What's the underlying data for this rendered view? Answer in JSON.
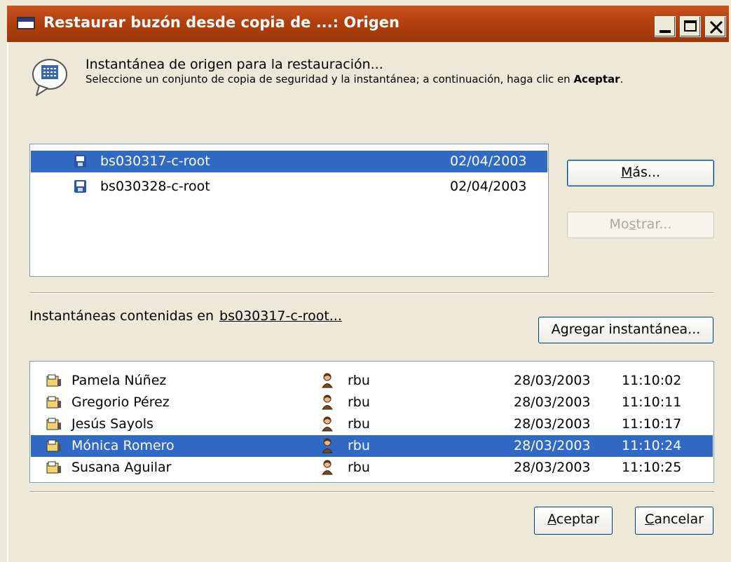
{
  "window": {
    "title": "Restaurar buzón desde copia de ...: Origen"
  },
  "header": {
    "title": "Instantánea de origen para la restauración...",
    "subtitle_prefix": "Seleccione un conjunto de copia de seguridad y la instantánea; a continuación, haga clic en ",
    "subtitle_bold": "Aceptar",
    "subtitle_suffix": "."
  },
  "backup_sets": [
    {
      "name": "bs030317-c-root",
      "date": "02/04/2003",
      "selected": true
    },
    {
      "name": "bs030328-c-root",
      "date": "02/04/2003",
      "selected": false
    }
  ],
  "buttons": {
    "more_hot": "M",
    "more_rest": "ás...",
    "show_pre": "Mo",
    "show_hot": "s",
    "show_rest": "trar...",
    "add_pre": "A",
    "add_hot": "g",
    "add_rest": "regar instantánea...",
    "ok_hot": "A",
    "ok_rest": "ceptar",
    "cancel_hot": "C",
    "cancel_rest": "ancelar"
  },
  "snapshots_label": "Instantáneas contenidas en",
  "snapshots_source": "bs030317-c-root...",
  "snapshots": [
    {
      "name": "Pamela Núñez",
      "user": "rbu",
      "date": "28/03/2003",
      "time": "11:10:02",
      "selected": false
    },
    {
      "name": "Gregorio Pérez",
      "user": "rbu",
      "date": "28/03/2003",
      "time": "11:10:11",
      "selected": false
    },
    {
      "name": "Jesús Sayols",
      "user": "rbu",
      "date": "28/03/2003",
      "time": "11:10:17",
      "selected": false
    },
    {
      "name": "Mónica Romero",
      "user": "rbu",
      "date": "28/03/2003",
      "time": "11:10:24",
      "selected": true
    },
    {
      "name": "Susana Aguilar",
      "user": "rbu",
      "date": "28/03/2003",
      "time": "11:10:25",
      "selected": false
    }
  ],
  "colors": {
    "titlebar": "#B1400E",
    "selection": "#316AC5",
    "dialog_bg": "#ECE9D8"
  }
}
